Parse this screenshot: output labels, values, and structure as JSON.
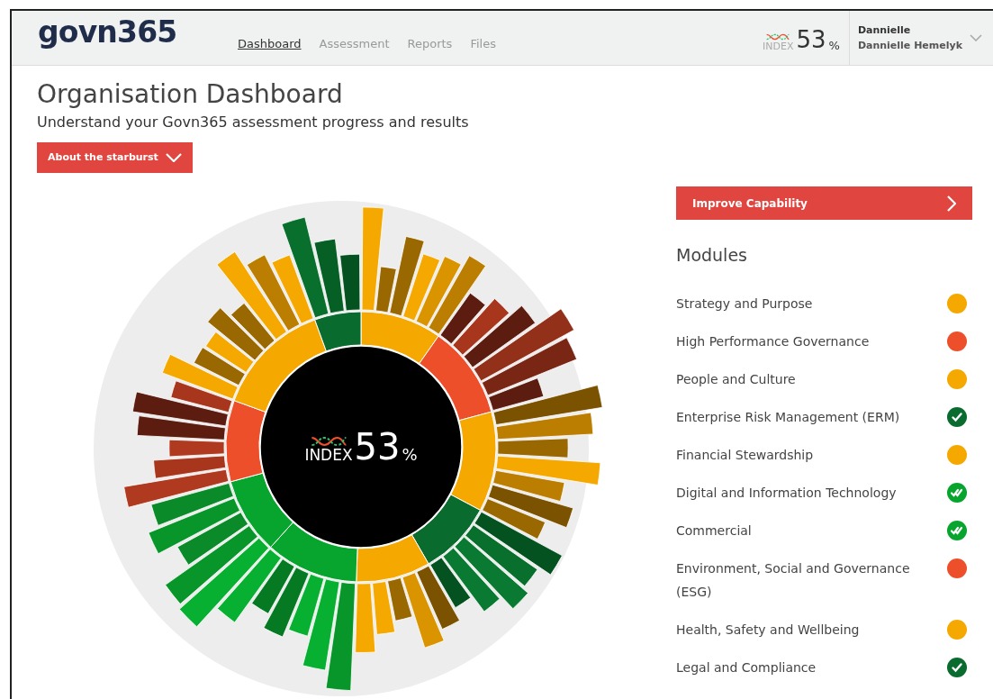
{
  "header": {
    "logo": "govn365",
    "nav": [
      {
        "label": "Dashboard",
        "selected": true
      },
      {
        "label": "Assessment",
        "selected": false
      },
      {
        "label": "Reports",
        "selected": false
      },
      {
        "label": "Files",
        "selected": false
      }
    ],
    "index": {
      "label": "INDEX",
      "value": "53",
      "unit": "%"
    },
    "user": {
      "name": "Dannielle",
      "full_name": "Dannielle Hemelyk"
    }
  },
  "title": "Organisation Dashboard",
  "subtitle": "Understand your Govn365 assessment progress and results",
  "about_button": "About the starburst",
  "starburst": {
    "center": {
      "label": "INDEX",
      "value": "53",
      "unit": "%"
    }
  },
  "improve_button": "Improve Capability",
  "modules_heading": "Modules",
  "modules": [
    {
      "name": "Strategy and Purpose",
      "kind": "dot",
      "color": "#f5a800"
    },
    {
      "name": "High Performance Governance",
      "kind": "dot",
      "color": "#ee4f2b"
    },
    {
      "name": "People and Culture",
      "kind": "dot",
      "color": "#f5a800"
    },
    {
      "name": "Enterprise Risk Management (ERM)",
      "kind": "check",
      "color": "#0a6b2e"
    },
    {
      "name": "Financial Stewardship",
      "kind": "dot",
      "color": "#f5a800"
    },
    {
      "name": "Digital and Information Technology",
      "kind": "double_check",
      "color": "#07a52e"
    },
    {
      "name": "Commercial",
      "kind": "double_check",
      "color": "#07a52e"
    },
    {
      "name": "Environment, Social and Governance (ESG)",
      "kind": "dot",
      "color": "#ee4f2b"
    },
    {
      "name": "Health, Safety and Wellbeing",
      "kind": "dot",
      "color": "#f5a800"
    },
    {
      "name": "Legal and Compliance",
      "kind": "check",
      "color": "#0a6b2e"
    }
  ]
}
